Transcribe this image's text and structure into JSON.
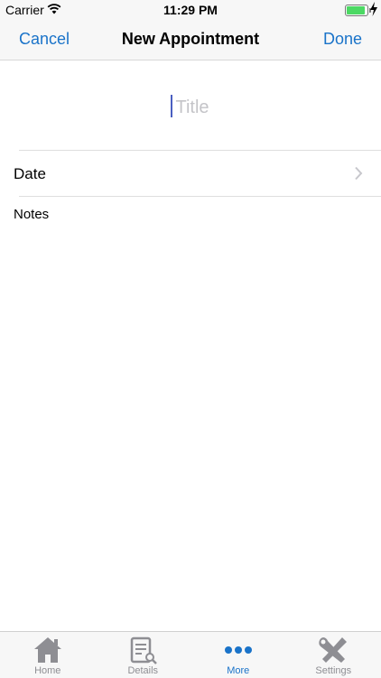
{
  "status_bar": {
    "carrier": "Carrier",
    "time": "11:29 PM",
    "battery_level": 0.9,
    "battery_color": "#4cd964"
  },
  "nav": {
    "cancel_label": "Cancel",
    "title": "New Appointment",
    "done_label": "Done",
    "accent_color": "#1a73c9"
  },
  "form": {
    "title_placeholder": "Title",
    "title_value": "",
    "date_label": "Date",
    "notes_label": "Notes",
    "notes_value": ""
  },
  "tab_bar": {
    "active": "More",
    "tabs": [
      {
        "label": "Home",
        "icon": "home-icon"
      },
      {
        "label": "Details",
        "icon": "document-search-icon"
      },
      {
        "label": "More",
        "icon": "more-dots-icon"
      },
      {
        "label": "Settings",
        "icon": "tools-icon"
      }
    ]
  }
}
